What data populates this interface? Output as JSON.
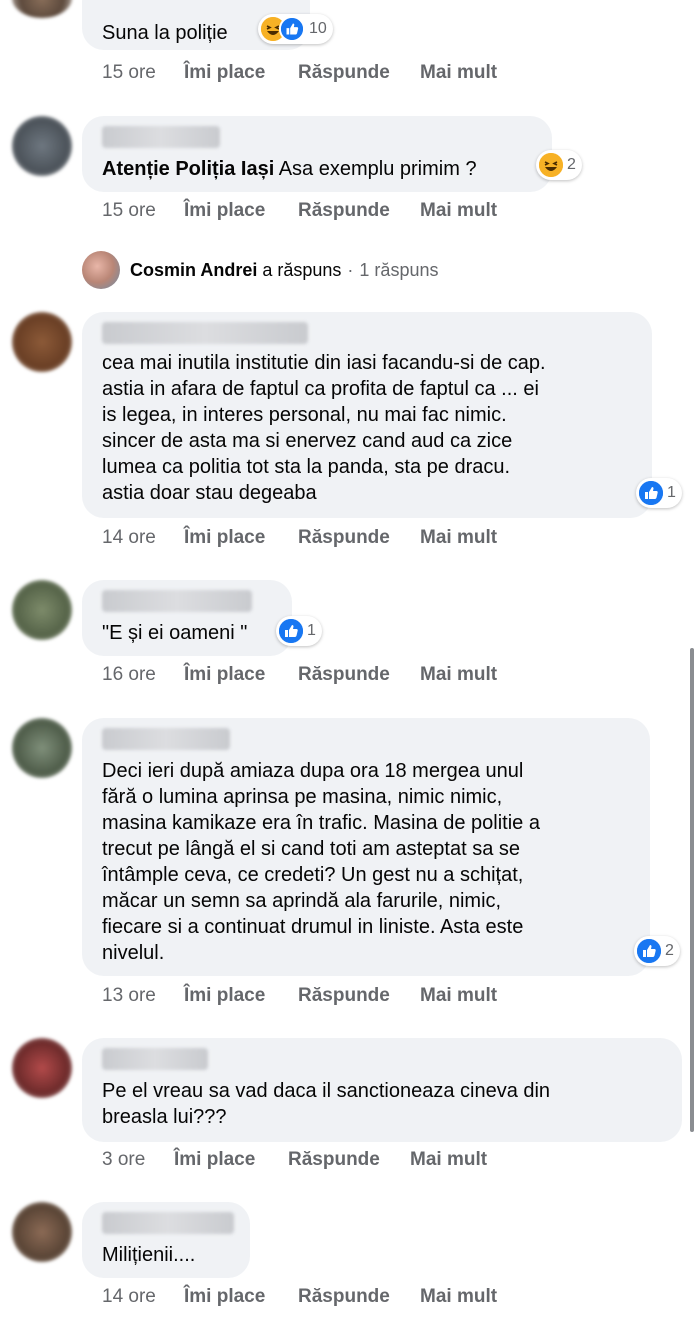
{
  "comments": [
    {
      "text": "Suna la poliție",
      "reactions": {
        "count": "10",
        "icons": [
          "haha-icon",
          "like-icon"
        ]
      },
      "time": "15 ore"
    },
    {
      "tag": "Atenție Poliția Iași",
      "text": " Asa exemplu primim ?",
      "reactions": {
        "count": "2",
        "icons": [
          "haha-icon"
        ]
      },
      "time": "15 ore"
    },
    {
      "text": "cea mai inutila institutie din iasi facandu-si de cap.\nastia in afara de faptul ca profita de faptul ca ... ei\nis legea, in interes personal, nu mai fac nimic.\nsincer de asta ma si enervez cand aud ca zice\nlumea ca politia tot sta la panda, sta pe dracu.\nastia doar stau degeaba",
      "reactions": {
        "count": "1",
        "icons": [
          "like-icon"
        ]
      },
      "time": "14 ore"
    },
    {
      "text": "\"E și ei oameni \"",
      "reactions": {
        "count": "1",
        "icons": [
          "like-icon"
        ]
      },
      "time": "16 ore"
    },
    {
      "text": "Deci ieri după amiaza dupa ora 18 mergea unul\nfără o lumina aprinsa pe masina, nimic nimic,\nmasina kamikaze era în trafic. Masina de politie a\ntrecut pe lângă el si cand toti am asteptat sa se\nîntâmple ceva, ce credeti? Un gest nu a schițat,\nmăcar un semn sa aprindă ala farurile, nimic,\nfiecare si a continuat drumul in liniste. Asta este\nnivelul.",
      "reactions": {
        "count": "2",
        "icons": [
          "like-icon"
        ]
      },
      "time": "13 ore"
    },
    {
      "text": "Pe el vreau sa vad daca il sanctioneaza cineva din\nbreasla lui???",
      "time": "3 ore"
    },
    {
      "text": "Milițienii....",
      "time": "14 ore"
    }
  ],
  "actions": {
    "like": "Îmi place",
    "reply": "Răspunde",
    "more": "Mai mult"
  },
  "reply_summary": {
    "name": "Cosmin Andrei",
    "action": " a răspuns",
    "separator": "·",
    "count": "1 răspuns"
  },
  "colors": {
    "bubble": "#f0f2f5",
    "like": "#1877f2",
    "haha": "#f7b125",
    "meta": "#65676b"
  }
}
